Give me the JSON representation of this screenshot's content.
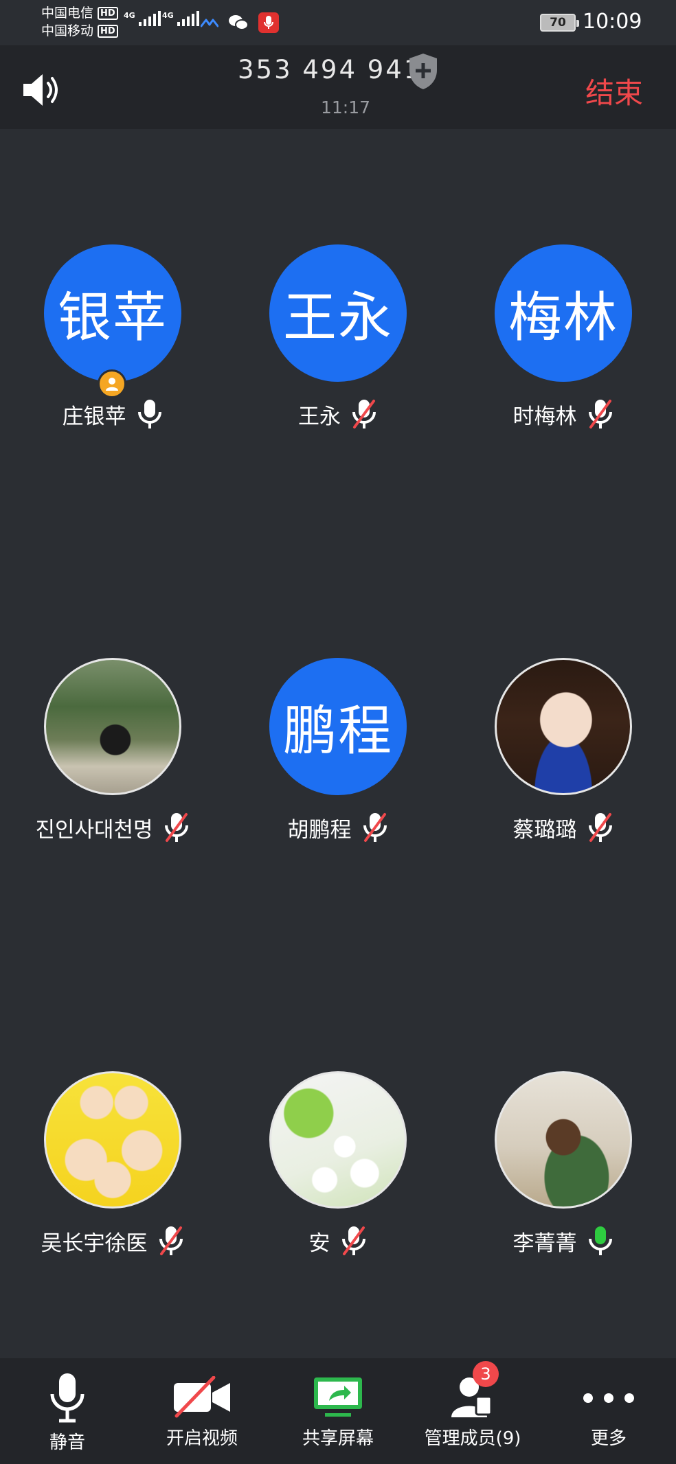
{
  "status_bar": {
    "carrier_1": "中国电信",
    "carrier_2": "中国移动",
    "hd_1": "HD",
    "hd_2": "HD",
    "net_1": "4G",
    "net_2": "4G",
    "battery": "70",
    "time": "10:09"
  },
  "header": {
    "meeting_id": "353 494 941",
    "duration": "11:17",
    "end_label": "结束"
  },
  "participants": [
    {
      "name": "庄银苹",
      "avatar_text": "银苹",
      "mic": "on",
      "host": true
    },
    {
      "name": "王永",
      "avatar_text": "王永",
      "mic": "muted"
    },
    {
      "name": "时梅林",
      "avatar_text": "梅林",
      "mic": "muted"
    },
    {
      "name": "진인사대천명",
      "avatar_photo": "forest-photo",
      "mic": "muted"
    },
    {
      "name": "胡鹏程",
      "avatar_text": "鹏程",
      "mic": "muted"
    },
    {
      "name": "蔡璐璐",
      "avatar_photo": "girl-photo",
      "mic": "muted"
    },
    {
      "name": "吴长宇徐医",
      "avatar_photo": "cartoon-family-photo",
      "mic": "muted"
    },
    {
      "name": "安",
      "avatar_photo": "daisy-photo",
      "mic": "muted"
    },
    {
      "name": "李菁菁",
      "avatar_photo": "child-photo",
      "mic": "speaking"
    }
  ],
  "toolbar": {
    "mute_label": "静音",
    "video_label": "开启视频",
    "share_label": "共享屏幕",
    "members_label": "管理成员(9)",
    "members_badge": "3",
    "more_label": "更多"
  },
  "colors": {
    "accent_blue": "#1d6ff2",
    "end_red": "#f0484b",
    "share_green": "#2db84d",
    "speaking_green": "#2ecc40",
    "host_orange": "#f5a623"
  }
}
